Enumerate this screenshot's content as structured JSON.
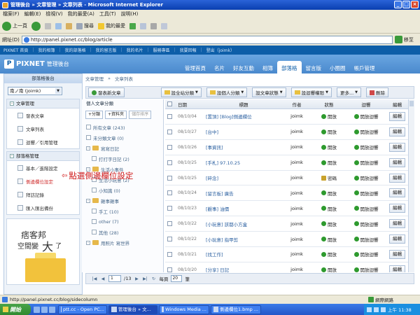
{
  "window": {
    "title": "管理後台 » 文章管理 » 文章列表 - Microsoft Internet Explorer"
  },
  "menu": [
    "檔案(F)",
    "編輯(E)",
    "檢視(V)",
    "我的最愛(A)",
    "工具(T)",
    "說明(H)"
  ],
  "toolbar": {
    "back": "上一頁",
    "search": "搜尋",
    "favorites": "我的最愛"
  },
  "address": {
    "label": "網址(D)",
    "url": "http://panel.pixnet.cc/blog/article",
    "go": "移至"
  },
  "pixnet_top": [
    "PIXNET 首頁",
    "我的相簿",
    "我的部落格",
    "我的留言版",
    "我的名片",
    "服務專區",
    "我要回報",
    "登出（joimk）"
  ],
  "brand": {
    "name": "PIXNET",
    "sub": "管理後台"
  },
  "nav_tabs": [
    "管理首頁",
    "名片",
    "好友互動",
    "相簿",
    "部落格",
    "留言版",
    "小圈圈",
    "帳戶管理"
  ],
  "breadcrumb": [
    "文章管理",
    "»",
    "文章列表"
  ],
  "sidebar": {
    "title": "部落格後台",
    "account": "南ノ南 (joimk)",
    "groups": [
      {
        "title": "文章管理",
        "items": [
          "發表文章",
          "文章列表",
          "迴響／引用管理"
        ]
      },
      {
        "title": "部落格管理",
        "items": [
          "基本／進階設定",
          "側邊欄位設定",
          "拜訪記錄",
          "匯入匯出備份"
        ]
      }
    ],
    "ad": {
      "line1": "痞客邦",
      "line2": "空間變",
      "big": "大",
      "end": "了"
    }
  },
  "annotation": "點選側邊欄位設定",
  "buttons": {
    "new_post": "發表新文章",
    "site_category": "設全站分類",
    "personal_category": "設個人分類",
    "article_status": "設文章狀態",
    "comment_permission": "設迴響權限",
    "more": "更多...",
    "delete": "刪除"
  },
  "categories": {
    "title": "個人文章分類",
    "actions": [
      "+分類",
      "+資料夾",
      "儲存排序"
    ],
    "items": [
      {
        "label": "所有文章 (243)",
        "kind": "doc",
        "level": 0
      },
      {
        "label": "未分類文章 (0)",
        "kind": "doc",
        "level": 0
      },
      {
        "label": "寫寫日記",
        "kind": "folder",
        "level": 0
      },
      {
        "label": "打打字日記 (2)",
        "kind": "doc",
        "level": 1
      },
      {
        "label": "生活小事件",
        "kind": "folder",
        "level": 0
      },
      {
        "label": "生活小玩意 (2)",
        "kind": "doc",
        "level": 1
      },
      {
        "label": "小知識 (0)",
        "kind": "doc",
        "level": 1
      },
      {
        "label": "雜事雜事",
        "kind": "folder",
        "level": 0
      },
      {
        "label": "手工 (10)",
        "kind": "doc",
        "level": 1
      },
      {
        "label": "other (7)",
        "kind": "doc",
        "level": 1
      },
      {
        "label": "其他 (28)",
        "kind": "doc",
        "level": 1
      },
      {
        "label": "用照片 寫世界",
        "kind": "folder",
        "level": 0
      }
    ]
  },
  "table": {
    "headers": [
      "日期",
      "標題",
      "作者",
      "狀態",
      "迴響",
      "編輯"
    ],
    "rows": [
      {
        "date": "08/10/04",
        "title": "[置頂] [Blog]側邊欄位",
        "author": "joimk",
        "status": "開放",
        "comment": "開放迴響",
        "edit": "編輯",
        "locked": false
      },
      {
        "date": "08/10/27",
        "title": "[台中]",
        "author": "joimk",
        "status": "開放",
        "comment": "開放迴響",
        "edit": "編輯",
        "locked": false
      },
      {
        "date": "08/10/26",
        "title": "[事資訊]",
        "author": "joimk",
        "status": "開放",
        "comment": "開放迴響",
        "edit": "編輯",
        "locked": false
      },
      {
        "date": "08/10/25",
        "title": "[手札] 97.10.25",
        "author": "joimk",
        "status": "開放",
        "comment": "開放迴響",
        "edit": "編輯",
        "locked": false
      },
      {
        "date": "08/10/25",
        "title": "[碎念]",
        "author": "joimk",
        "status": "密碼",
        "comment": "開放迴響",
        "edit": "編輯",
        "locked": true
      },
      {
        "date": "08/10/24",
        "title": "[留言板] 廣告",
        "author": "joimk",
        "status": "開放",
        "comment": "開放迴響",
        "edit": "編輯",
        "locked": false
      },
      {
        "date": "08/10/23",
        "title": "[觀事] 油價",
        "author": "joimk",
        "status": "開放",
        "comment": "開放迴響",
        "edit": "編輯",
        "locked": false
      },
      {
        "date": "08/10/22",
        "title": "[小玩意] 該都小方盒",
        "author": "joimk",
        "status": "開放",
        "comment": "開放迴響",
        "edit": "編輯",
        "locked": false
      },
      {
        "date": "08/10/22",
        "title": "[小玩意] 指甲剪",
        "author": "joimk",
        "status": "開放",
        "comment": "開放迴響",
        "edit": "編輯",
        "locked": false
      },
      {
        "date": "08/10/21",
        "title": "[找工作]",
        "author": "joimk",
        "status": "開放",
        "comment": "開放迴響",
        "edit": "編輯",
        "locked": false
      },
      {
        "date": "08/10/20",
        "title": "[分享] 日記",
        "author": "joimk",
        "status": "開放",
        "comment": "開放迴響",
        "edit": "編輯",
        "locked": false
      }
    ]
  },
  "pager": {
    "page": "1",
    "of": "/13",
    "per_page_label": "每頁",
    "per_page": "20",
    "unit": "筆"
  },
  "statusbar": {
    "url": "http://panel.pixnet.cc/blog/sidecolumn",
    "zone": "網際網路"
  },
  "taskbar": {
    "start": "開始",
    "tasks": [
      "ptt.cc - Open PC...",
      "管理後台 » 文...",
      "Windows Media ...",
      "側邊欄位1.bmp ..."
    ],
    "time": "上午 11:38"
  },
  "colors": {
    "brand_blue": "#0d5ea8",
    "header_blue": "#5a96d6",
    "annotation_red": "#d01818",
    "ok_green": "#2e9a2e"
  }
}
